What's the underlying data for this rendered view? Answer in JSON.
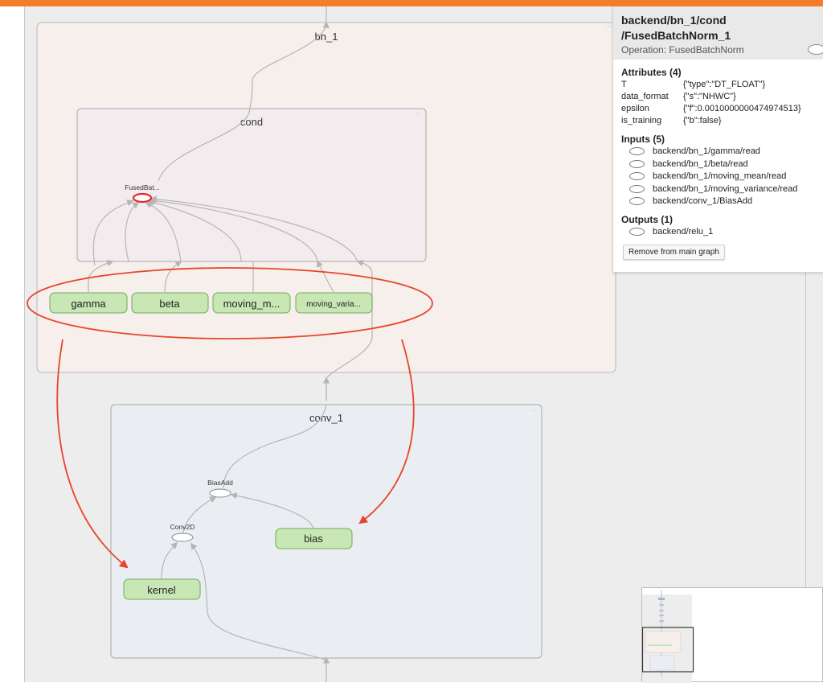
{
  "colors": {
    "topbar": "#f57c2a",
    "canvas": "#ededed",
    "group_bn1": "#f6efec",
    "group_cond": "#f3ecee",
    "group_conv1": "#eaeef3",
    "const_node_fill": "#c9e7b5",
    "const_node_stroke": "#6ea85a",
    "annotation": "#e8452a"
  },
  "graph": {
    "groups": {
      "bn_1": "bn_1",
      "cond": "cond",
      "conv_1": "conv_1"
    },
    "ops": {
      "fused": "FusedBat...",
      "biasadd": "BiasAdd",
      "conv2d": "Conv2D"
    },
    "constants": {
      "gamma": "gamma",
      "beta": "beta",
      "moving_mean": "moving_m...",
      "moving_variance": "moving_varia...",
      "bias": "bias",
      "kernel": "kernel"
    }
  },
  "info": {
    "title_line1": "backend/bn_1/cond",
    "title_line2": "/FusedBatchNorm_1",
    "operation": "Operation: FusedBatchNorm",
    "attributes_heading": "Attributes (4)",
    "attributes": [
      {
        "key": "T",
        "value": "{\"type\":\"DT_FLOAT\"}"
      },
      {
        "key": "data_format",
        "value": "{\"s\":\"NHWC\"}"
      },
      {
        "key": "epsilon",
        "value": "{\"f\":0.0010000000474974513}"
      },
      {
        "key": "is_training",
        "value": "{\"b\":false}"
      }
    ],
    "inputs_heading": "Inputs (5)",
    "inputs": [
      "backend/bn_1/gamma/read",
      "backend/bn_1/beta/read",
      "backend/bn_1/moving_mean/read",
      "backend/bn_1/moving_variance/read",
      "backend/conv_1/BiasAdd"
    ],
    "outputs_heading": "Outputs (1)",
    "outputs": [
      "backend/relu_1"
    ],
    "remove_button": "Remove from main graph"
  }
}
